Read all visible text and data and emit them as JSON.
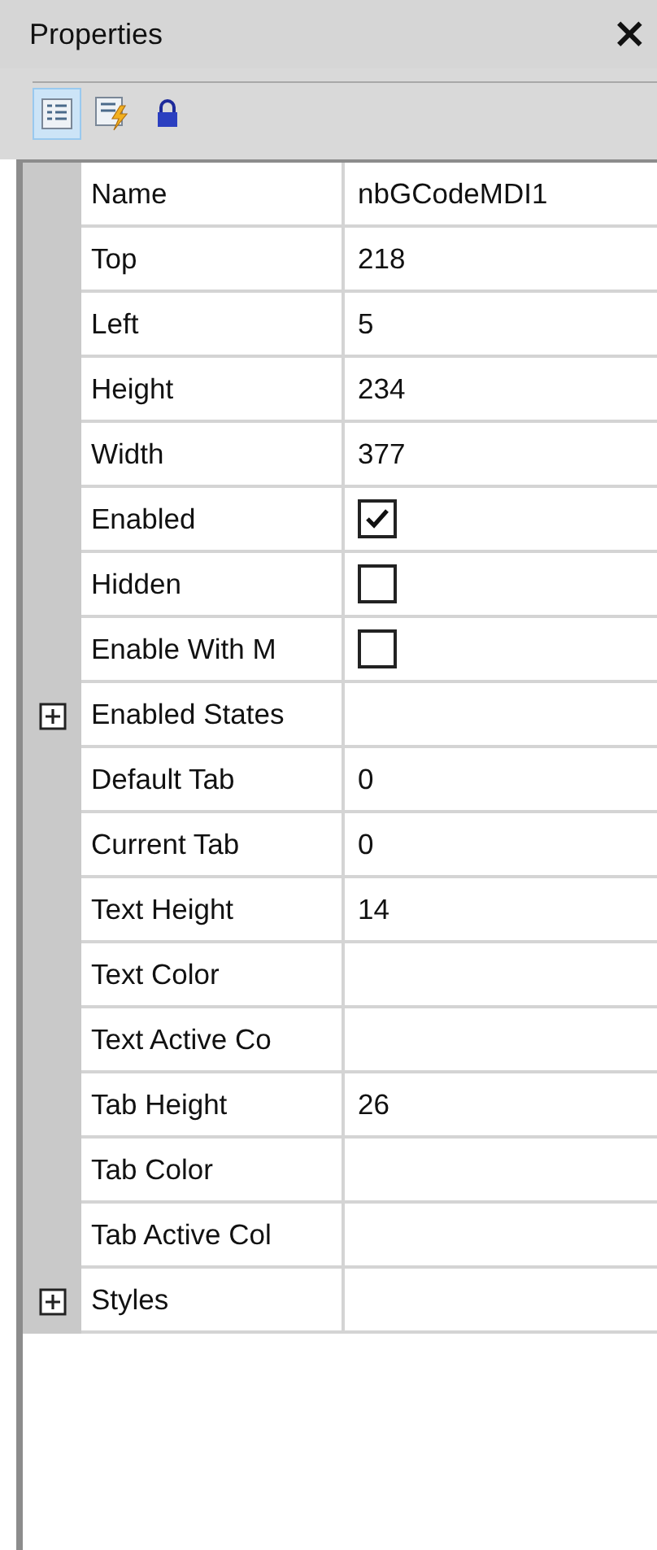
{
  "panel": {
    "title": "Properties",
    "close": "×"
  },
  "toolbar": [
    {
      "kind": "categorized",
      "selected": true
    },
    {
      "kind": "events",
      "selected": false
    },
    {
      "kind": "lock",
      "selected": false
    }
  ],
  "rows": [
    {
      "kind": "text",
      "name": "Name",
      "value": "nbGCodeMDI1"
    },
    {
      "kind": "text",
      "name": "Top",
      "value": "218"
    },
    {
      "kind": "text",
      "name": "Left",
      "value": "5"
    },
    {
      "kind": "text",
      "name": "Height",
      "value": "234"
    },
    {
      "kind": "text",
      "name": "Width",
      "value": "377"
    },
    {
      "kind": "check",
      "name": "Enabled",
      "checked": true
    },
    {
      "kind": "check",
      "name": "Hidden",
      "checked": false
    },
    {
      "kind": "check",
      "name": "Enable With M",
      "checked": false
    },
    {
      "kind": "group",
      "name": "Enabled States",
      "expanded": false
    },
    {
      "kind": "text",
      "name": "Default Tab",
      "value": "0"
    },
    {
      "kind": "text",
      "name": "Current Tab",
      "value": "0"
    },
    {
      "kind": "text",
      "name": "Text Height",
      "value": "14"
    },
    {
      "kind": "text",
      "name": "Text Color"
    },
    {
      "kind": "text",
      "name": "Text Active Co"
    },
    {
      "kind": "text",
      "name": "Tab Height",
      "value": "26"
    },
    {
      "kind": "text",
      "name": "Tab Color"
    },
    {
      "kind": "text",
      "name": "Tab Active Col"
    },
    {
      "kind": "group",
      "name": "Styles",
      "expanded": false
    }
  ]
}
